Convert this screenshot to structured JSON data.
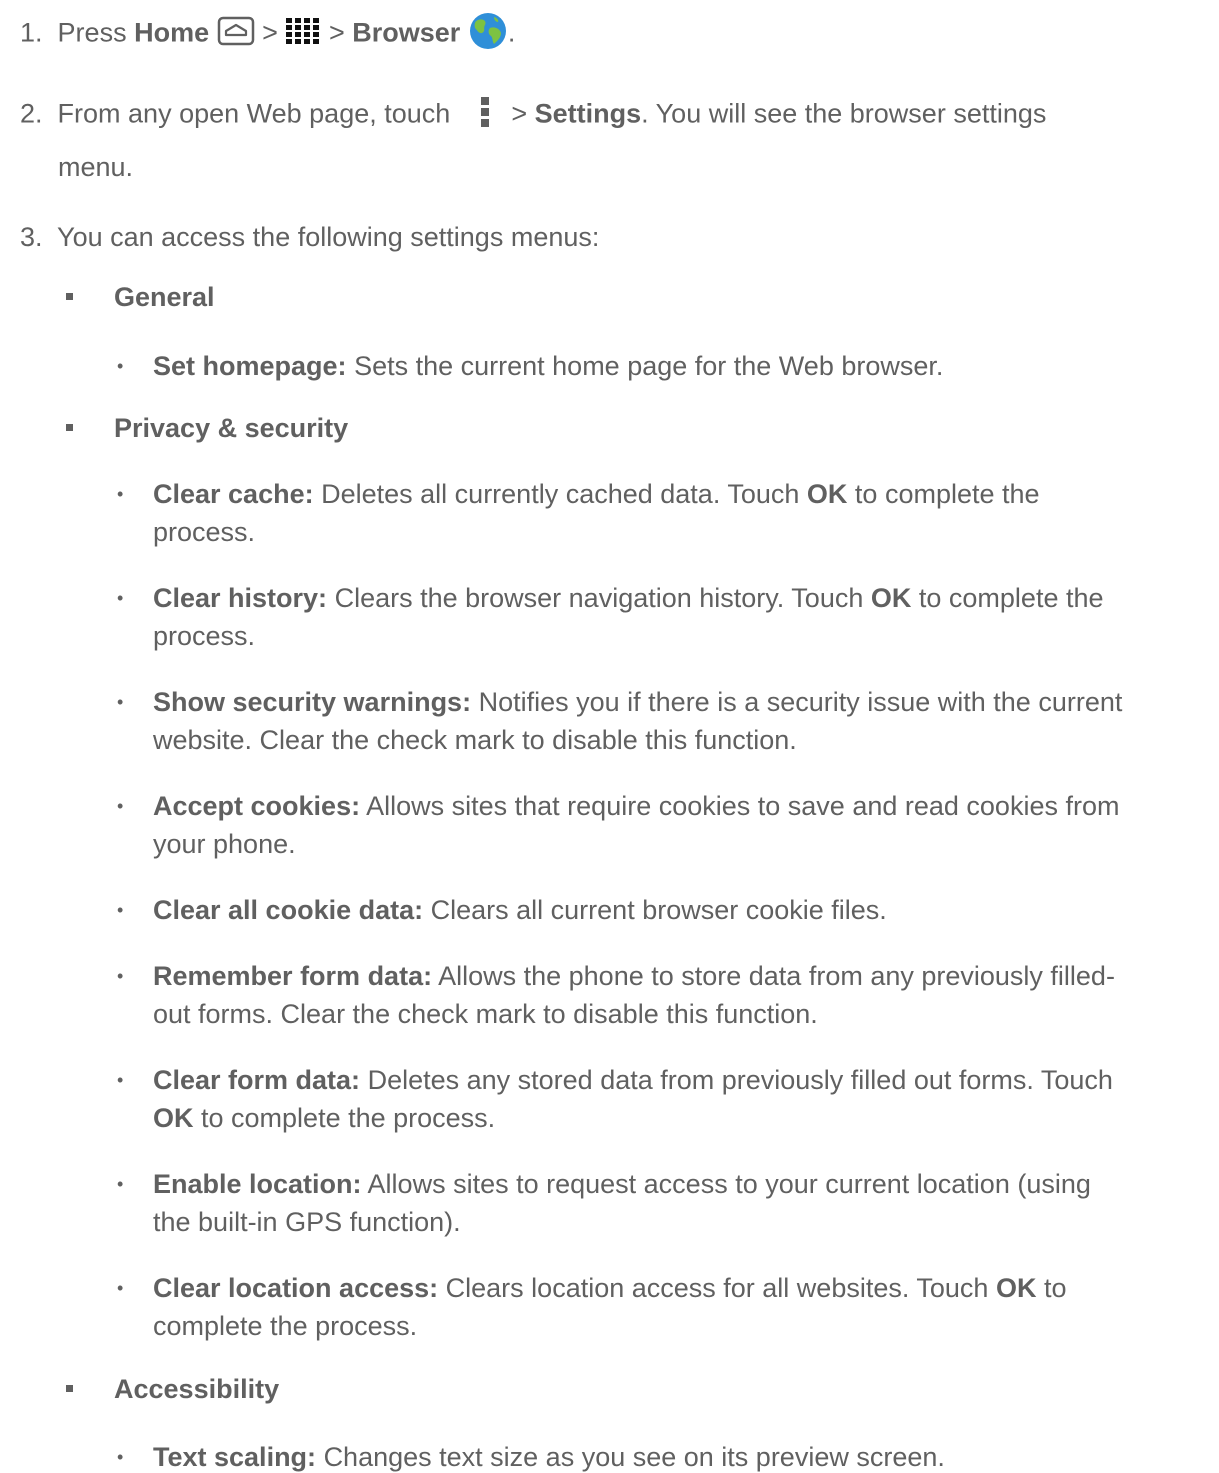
{
  "steps": {
    "s1": {
      "num": "1.",
      "press": "Press",
      "home": "Home",
      "gt1": ">",
      "gt2": ">",
      "browser": "Browser",
      "end": "."
    },
    "s2": {
      "num": "2.",
      "pre": "From any open Web page, touch",
      "gt": ">",
      "settings": "Settings",
      "post": ". You will see the browser settings",
      "cont": "menu."
    },
    "s3": {
      "num": "3.",
      "text": "You can access the following settings menus:"
    }
  },
  "sections": {
    "general": "General",
    "privacy": "Privacy & security",
    "accessibility": "Accessibility"
  },
  "items": {
    "set_homepage": {
      "term": "Set homepage:",
      "desc": "Sets the current home page for the Web browser."
    },
    "clear_cache": {
      "term": "Clear cache:",
      "desc1": "Deletes all currently cached data. Touch",
      "ok": "OK",
      "desc2": "to complete the",
      "cont": "process."
    },
    "clear_history": {
      "term": "Clear history:",
      "desc1": "Clears the browser navigation history. Touch",
      "ok": "OK",
      "desc2": "to complete the",
      "cont": "process."
    },
    "security_warnings": {
      "term": "Show security warnings:",
      "desc": "Notifies you if there is a security issue with the current",
      "cont": "website. Clear the check mark to disable this function."
    },
    "accept_cookies": {
      "term": "Accept cookies:",
      "desc": "Allows sites that require cookies to save and read cookies from",
      "cont": "your phone."
    },
    "clear_cookies": {
      "term": "Clear all cookie data:",
      "desc": "Clears all current browser cookie files."
    },
    "remember_form": {
      "term": "Remember form data:",
      "desc": "Allows the phone to store data from any previously filled-",
      "cont": "out forms. Clear the check mark to disable this function."
    },
    "clear_form": {
      "term": "Clear form data:",
      "desc": "Deletes any stored data from previously filled out forms. Touch",
      "ok": "OK",
      "cont": "to complete the process."
    },
    "enable_location": {
      "term": "Enable location:",
      "desc": "Allows sites to request access to your current location (using",
      "cont": "the built-in GPS function)."
    },
    "clear_location": {
      "term": "Clear location access:",
      "desc1": "Clears location access for all websites. Touch",
      "ok": "OK",
      "desc2": "to",
      "cont": "complete the process."
    },
    "text_scaling": {
      "term": "Text scaling:",
      "desc": "Changes text size as you see on its preview screen."
    }
  },
  "bullet_glyph": "•",
  "icons": {
    "home": "home-button-icon",
    "apps": "apps-grid-icon",
    "browser": "browser-globe-icon",
    "menu": "overflow-menu-icon"
  },
  "colors": {
    "text": "#606060",
    "globe_blue": "#2f8fd8",
    "globe_green": "#7dc242"
  }
}
